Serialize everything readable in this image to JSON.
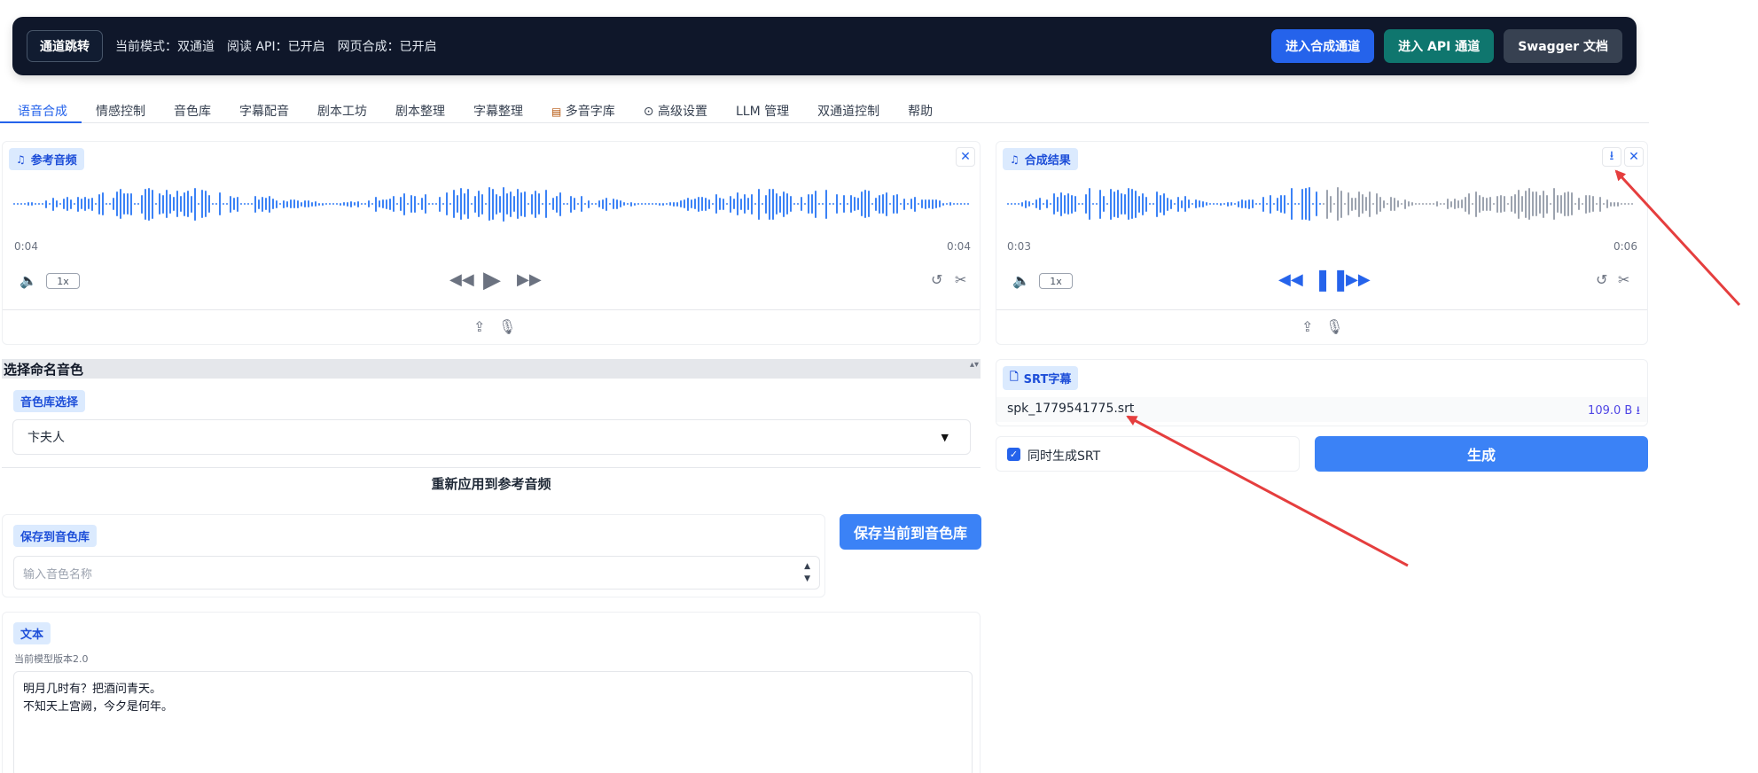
{
  "topbar": {
    "switch_label": "通道跳转",
    "mode_text": "当前模式：双通道",
    "read_api_text": "阅读 API：已开启",
    "web_synth_text": "网页合成：已开启",
    "btn_synth_channel": "进入合成通道",
    "btn_api_channel": "进入 API 通道",
    "btn_swagger": "Swagger 文档"
  },
  "tabs": [
    "语音合成",
    "情感控制",
    "音色库",
    "字幕配音",
    "剧本工坊",
    "剧本整理",
    "字幕整理",
    "多音字库",
    "⊙ 高级设置",
    "LLM 管理",
    "双通道控制",
    "帮助"
  ],
  "ref_audio": {
    "label": "参考音频",
    "time_left": "0:04",
    "time_right": "0:04",
    "rate": "1x"
  },
  "result_audio": {
    "label": "合成结果",
    "time_left": "0:03",
    "time_right": "0:06",
    "rate": "1x"
  },
  "voice_select": {
    "section_title": "选择命名音色",
    "chip": "音色库选择",
    "selected": "卞夫人",
    "reapply_label": "重新应用到参考音频"
  },
  "save_voice": {
    "chip": "保存到音色库",
    "placeholder": "输入音色名称",
    "button": "保存当前到音色库"
  },
  "text_panel": {
    "chip": "文本",
    "model_note": "当前模型版本2.0",
    "line1": "明月几时有？把酒问青天。",
    "line2": "不知天上宫阙，今夕是何年。"
  },
  "srt": {
    "chip": "SRT字幕",
    "filename": "spk_1779541775.srt",
    "size": "109.0 B ⭳",
    "checkbox_label": "同时生成SRT",
    "checkbox_checked": true,
    "generate_button": "生成"
  },
  "colors": {
    "accent": "#2563eb",
    "wave_played": "#3b82f6",
    "wave_unplayed": "#9ca3af",
    "arrow": "#e53e3e"
  }
}
